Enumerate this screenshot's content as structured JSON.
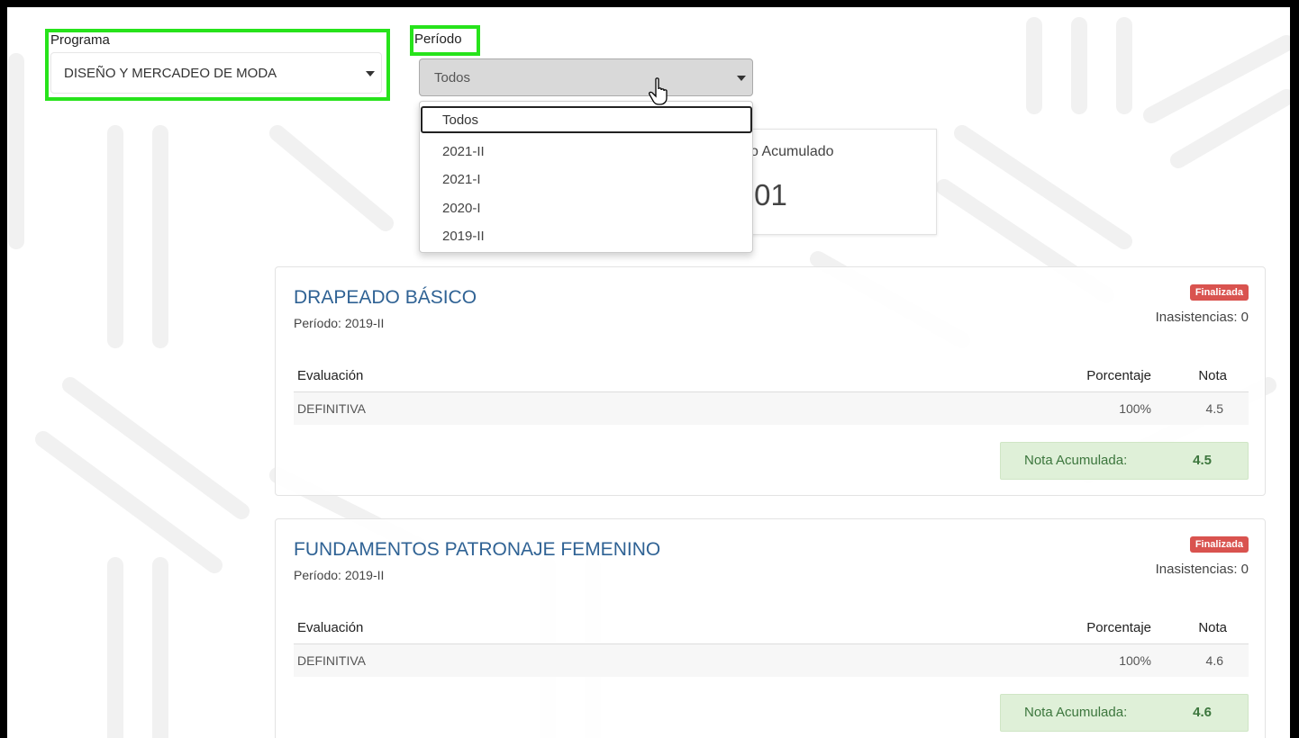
{
  "programa": {
    "label": "Programa",
    "selected": "DISEÑO Y MERCADEO DE MODA"
  },
  "periodo": {
    "label": "Período",
    "selected": "Todos",
    "options": [
      "Todos",
      "2021-II",
      "2021-I",
      "2020-I",
      "2019-II"
    ]
  },
  "promedio": {
    "label_visible": "o Acumulado",
    "value_visible": ".01"
  },
  "courses": [
    {
      "title": "DRAPEADO BÁSICO",
      "period": "Período: 2019-II",
      "status": "Finalizada",
      "absences": "Inasistencias: 0",
      "headers": {
        "eval": "Evaluación",
        "pct": "Porcentaje",
        "nota": "Nota"
      },
      "rows": [
        {
          "eval": "DEFINITIVA",
          "pct": "100%",
          "nota": "4.5"
        }
      ],
      "acum_label": "Nota Acumulada:",
      "acum_value": "4.5"
    },
    {
      "title": "FUNDAMENTOS PATRONAJE FEMENINO",
      "period": "Período: 2019-II",
      "status": "Finalizada",
      "absences": "Inasistencias: 0",
      "headers": {
        "eval": "Evaluación",
        "pct": "Porcentaje",
        "nota": "Nota"
      },
      "rows": [
        {
          "eval": "DEFINITIVA",
          "pct": "100%",
          "nota": "4.6"
        }
      ],
      "acum_label": "Nota Acumulada:",
      "acum_value": "4.6"
    }
  ],
  "colors": {
    "highlight": "#27e31b",
    "course_title": "#2f6294",
    "badge": "#d9534f",
    "acum_bg": "#dff0d8",
    "acum_text": "#3c763d"
  },
  "icons": [
    "chevron-down-icon",
    "hand-pointer-icon"
  ]
}
